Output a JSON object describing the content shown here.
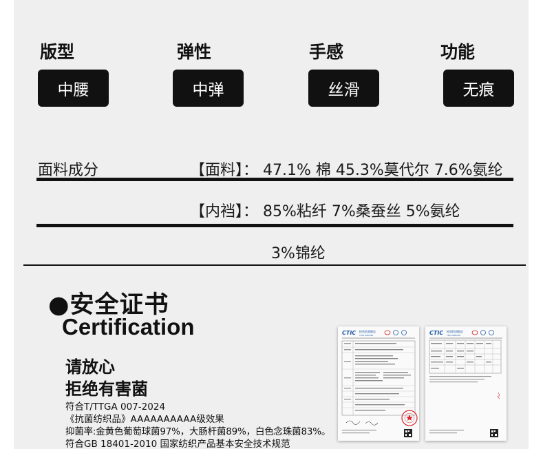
{
  "attributes": [
    {
      "label": "版型",
      "value": "中腰"
    },
    {
      "label": "弹性",
      "value": "中弹"
    },
    {
      "label": "手感",
      "value": "丝滑"
    },
    {
      "label": "功能",
      "value": "无痕"
    }
  ],
  "composition": {
    "title": "面料成分",
    "fabric": "【面料】：  47.1% 棉  45.3%莫代尔  7.6%氨纶",
    "lining": "【内裆】：  85%粘纤  7%桑蚕丝  5%氨纶",
    "lining_extra": "3%锦纶"
  },
  "certification": {
    "title": "●安全证书",
    "title_en": "Certification",
    "headline1": "请放心",
    "headline2": "拒绝有害菌",
    "lines": [
      "符合T/TTGA 007-2024",
      "《抗菌纺织品》AAAAAAAAAA级效果",
      "抑菌率:金黄色葡萄球菌97%，大肠杆菌89%，白色念珠菌83%。",
      "符合GB 18401-2010 国家纺织产品基本安全技术规范"
    ]
  },
  "reports": {
    "logo": "CTIC",
    "header": "检验检测报告",
    "subheader": "TEST REPORT"
  },
  "colors": {
    "background": "#efefef",
    "badge": "#111111",
    "badge_text": "#ffffff",
    "logo_blue": "#1f5aa6",
    "logo_red": "#d0252a",
    "stamp_red": "#d8282f"
  }
}
